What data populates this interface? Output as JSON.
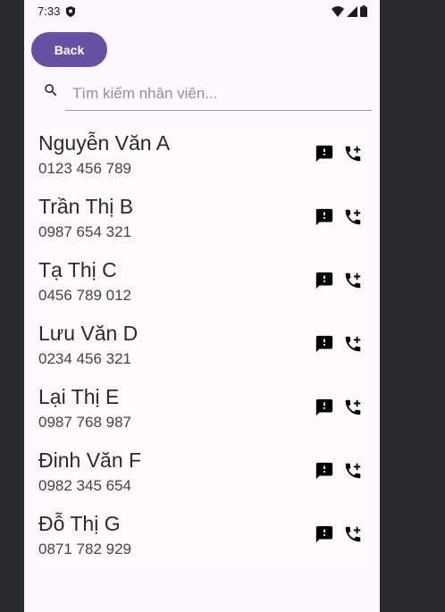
{
  "status": {
    "time": "7:33"
  },
  "back_label": "Back",
  "search": {
    "placeholder": "Tìm kiếm nhân viên...",
    "value": ""
  },
  "contacts": [
    {
      "name": "Nguyễn Văn A",
      "phone": "0123 456 789"
    },
    {
      "name": "Trần Thị B",
      "phone": "0987 654 321"
    },
    {
      "name": "Tạ Thị C",
      "phone": "0456 789 012"
    },
    {
      "name": "Lưu Văn D",
      "phone": "0234 456 321"
    },
    {
      "name": "Lại Thị E",
      "phone": "0987 768 987"
    },
    {
      "name": "Đinh Văn F",
      "phone": "0982 345 654"
    },
    {
      "name": "Đỗ Thị G",
      "phone": "0871 782 929"
    }
  ],
  "colors": {
    "accent": "#6750a4",
    "background": "#fef7ff",
    "frame": "#2a2b2f"
  },
  "icons": [
    "shield-icon",
    "wifi-icon",
    "signal-icon",
    "battery-icon",
    "search-icon",
    "feedback-icon",
    "add-call-icon"
  ]
}
